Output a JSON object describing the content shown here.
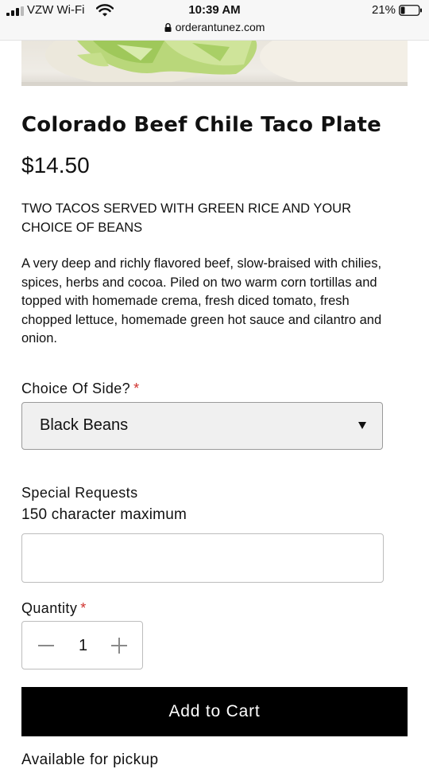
{
  "status_bar": {
    "carrier": "VZW Wi-Fi",
    "time": "10:39 AM",
    "url": "orderantunez.com",
    "battery_percent": "21%"
  },
  "product": {
    "title": "Colorado Beef Chile Taco Plate",
    "price": "$14.50",
    "subtitle": "TWO TACOS SERVED WITH GREEN RICE AND YOUR CHOICE OF BEANS",
    "description": "A very deep and richly flavored beef, slow-braised with chilies, spices, herbs and cocoa. Piled on two warm corn tortillas and topped with homemade crema, fresh diced tomato, fresh chopped lettuce, homemade green hot sauce and cilantro and onion."
  },
  "side_choice": {
    "label": "Choice Of Side?",
    "required_mark": "*",
    "selected": "Black Beans"
  },
  "special_requests": {
    "label": "Special Requests",
    "hint": "150 character maximum",
    "value": ""
  },
  "quantity": {
    "label": "Quantity",
    "required_mark": "*",
    "value": "1"
  },
  "add_to_cart_label": "Add to Cart",
  "pickup_note": "Available for pickup",
  "icons": {
    "signal": "cellular-signal-icon",
    "wifi": "wifi-icon",
    "lock": "lock-icon",
    "battery": "battery-icon",
    "caret": "caret-down-icon",
    "minus": "minus-icon",
    "plus": "plus-icon"
  },
  "colors": {
    "required": "#d0312d",
    "button_bg": "#000000",
    "select_bg": "#f0f0f0"
  }
}
